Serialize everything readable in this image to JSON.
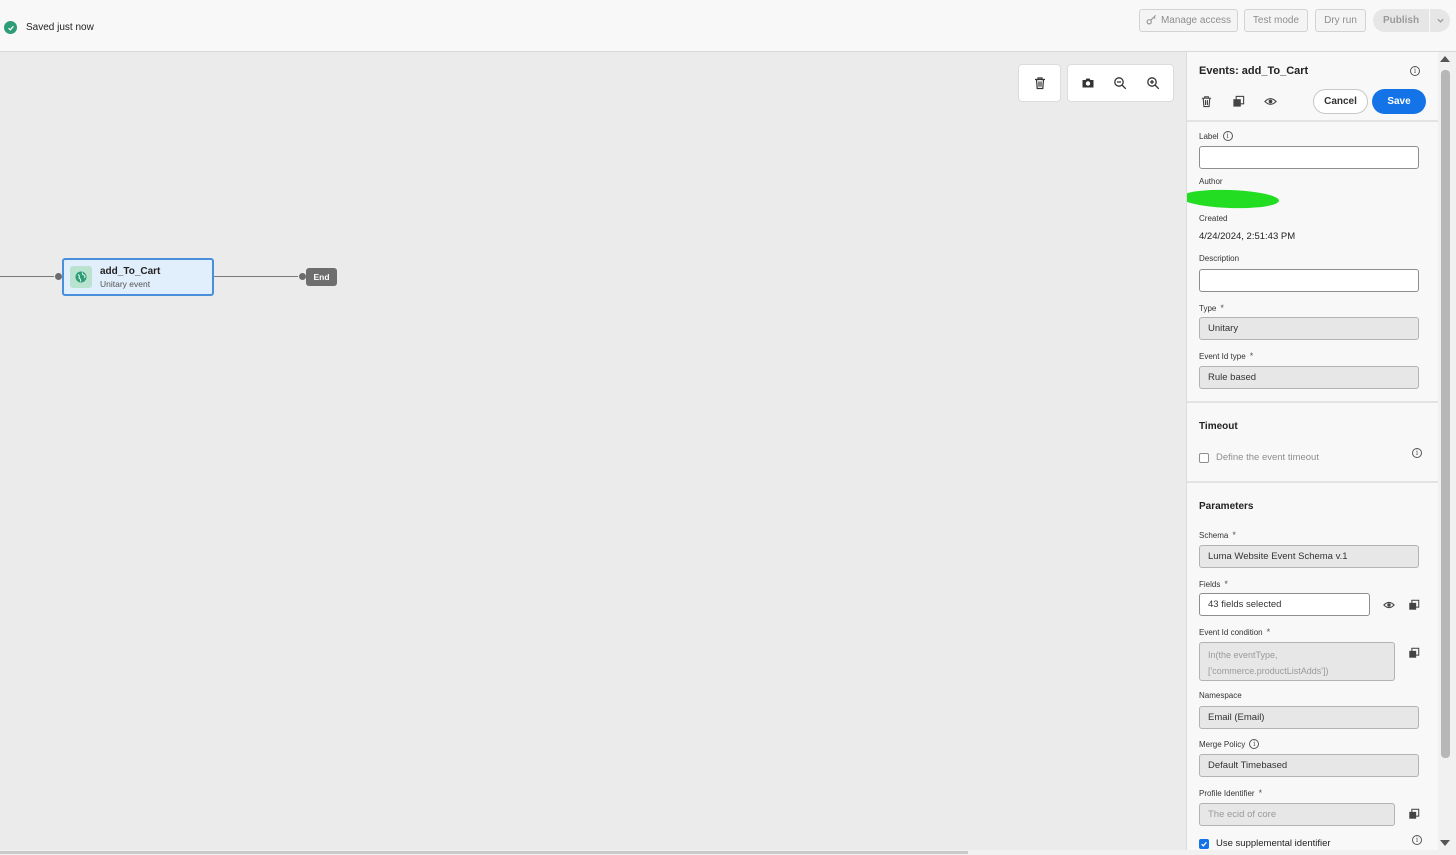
{
  "header": {
    "saved_text": "Saved just now",
    "buttons": {
      "manage_access": "Manage access",
      "test_mode": "Test mode",
      "dry_run": "Dry run",
      "publish": "Publish"
    }
  },
  "canvas": {
    "node": {
      "title": "add_To_Cart",
      "subtitle": "Unitary event"
    },
    "end_label": "End"
  },
  "panel": {
    "title": "Events: add_To_Cart",
    "cancel": "Cancel",
    "save": "Save",
    "fields": {
      "label": {
        "label": "Label",
        "value": ""
      },
      "author": {
        "label": "Author"
      },
      "created": {
        "label": "Created",
        "value": "4/24/2024, 2:51:43 PM"
      },
      "description": {
        "label": "Description",
        "value": ""
      },
      "type": {
        "label": "Type",
        "value": "Unitary"
      },
      "event_id_type": {
        "label": "Event Id type",
        "value": "Rule based"
      }
    },
    "timeout": {
      "heading": "Timeout",
      "checkbox_label": "Define the event timeout",
      "checked": false
    },
    "parameters": {
      "heading": "Parameters",
      "schema": {
        "label": "Schema",
        "value": "Luma Website Event Schema v.1"
      },
      "fields": {
        "label": "Fields",
        "value": "43 fields selected"
      },
      "event_id_condition": {
        "label": "Event Id condition",
        "line1": "In(the eventType,",
        "line2": "['commerce.productListAdds'])"
      },
      "namespace": {
        "label": "Namespace",
        "value": "Email (Email)"
      },
      "merge_policy": {
        "label": "Merge Policy",
        "value": "Default Timebased"
      },
      "profile_identifier": {
        "label": "Profile Identifier",
        "value": "The ecid of core"
      },
      "supplemental": {
        "label": "Use supplemental identifier",
        "checked": true
      }
    },
    "required_marker": "*"
  },
  "colors": {
    "accent": "#1473e6",
    "success": "#2d9d78",
    "canvas_bg": "#ebebeb",
    "node_border": "#4a8fd9",
    "redaction": "#22dd22"
  }
}
